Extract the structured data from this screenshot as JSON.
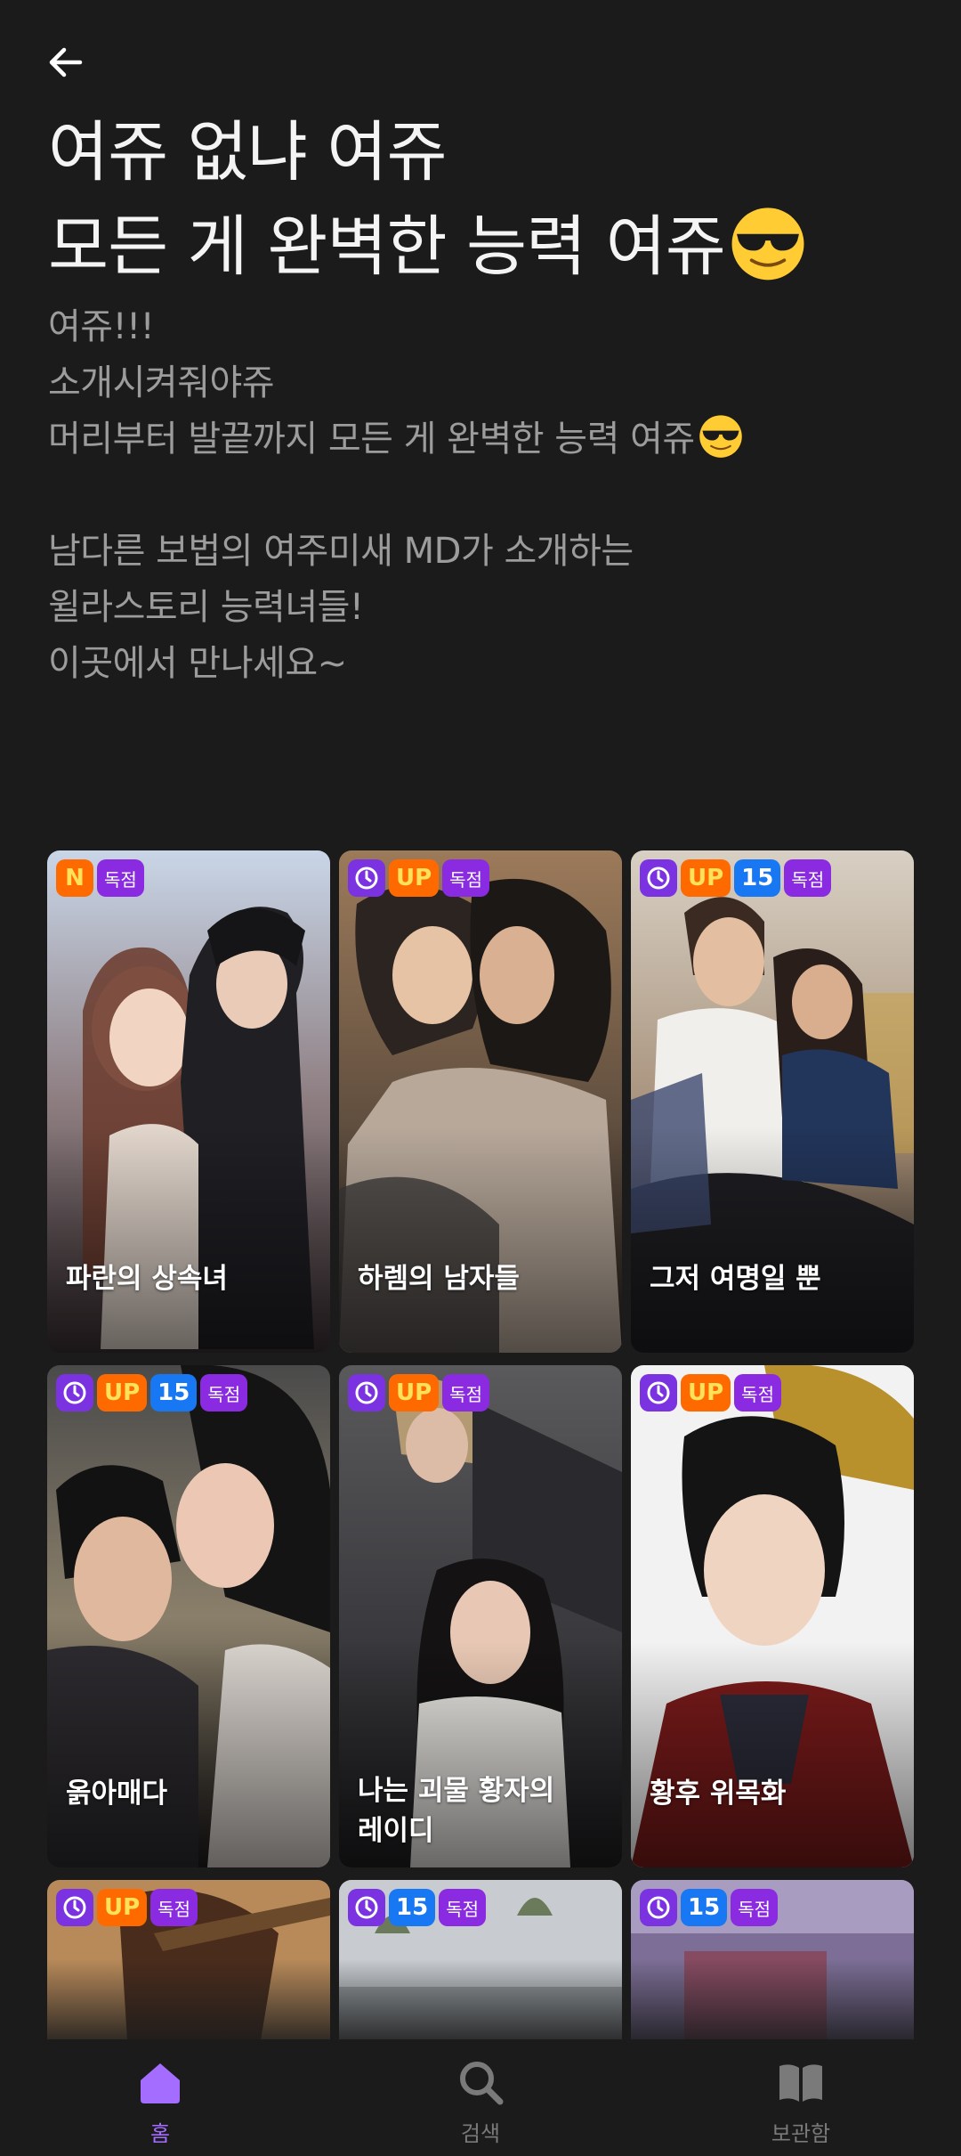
{
  "header": {
    "back_icon": "arrow-left-icon"
  },
  "title": {
    "line1": "여쥬 없냐 여쥬",
    "line2": "모든 게 완벽한 능력 여쥬",
    "emoji": "sunglasses-emoji"
  },
  "description": {
    "lines": [
      "여쥬!!!",
      "소개시켜줘야쥬",
      "머리부터 발끝까지 모든 게 완벽한 능력 여쥬",
      "",
      "남다른 보법의 여주미새 MD가 소개하는",
      "윌라스토리 능력녀들!",
      "이곳에서 만나세요~"
    ]
  },
  "cards": [
    {
      "title": "파란의 상속녀",
      "badges": [
        "N",
        "독점"
      ]
    },
    {
      "title": "하렘의 남자들",
      "badges": [
        "clock",
        "UP",
        "독점"
      ]
    },
    {
      "title": "그저 여명일 뿐",
      "badges": [
        "clock",
        "UP",
        "15",
        "독점"
      ]
    },
    {
      "title": "옭아매다",
      "badges": [
        "clock",
        "UP",
        "15",
        "독점"
      ]
    },
    {
      "title_line1": "나는 괴물 황자의",
      "title_line2": "레이디",
      "badges": [
        "clock",
        "UP",
        "독점"
      ]
    },
    {
      "title": "황후 위목화",
      "badges": [
        "clock",
        "UP",
        "독점"
      ]
    },
    {
      "badges": [
        "clock",
        "UP",
        "독점"
      ]
    },
    {
      "badges": [
        "clock",
        "15",
        "독점"
      ]
    },
    {
      "badges": [
        "clock",
        "15",
        "독점"
      ]
    }
  ],
  "tabbar": {
    "home": "홈",
    "search": "검색",
    "library": "보관함"
  },
  "colors": {
    "background": "#1b1b1c",
    "accent": "#a56dff",
    "badge_orange": "#ff6a00",
    "badge_blue": "#1877f2",
    "badge_purple": "#8a2be2"
  }
}
